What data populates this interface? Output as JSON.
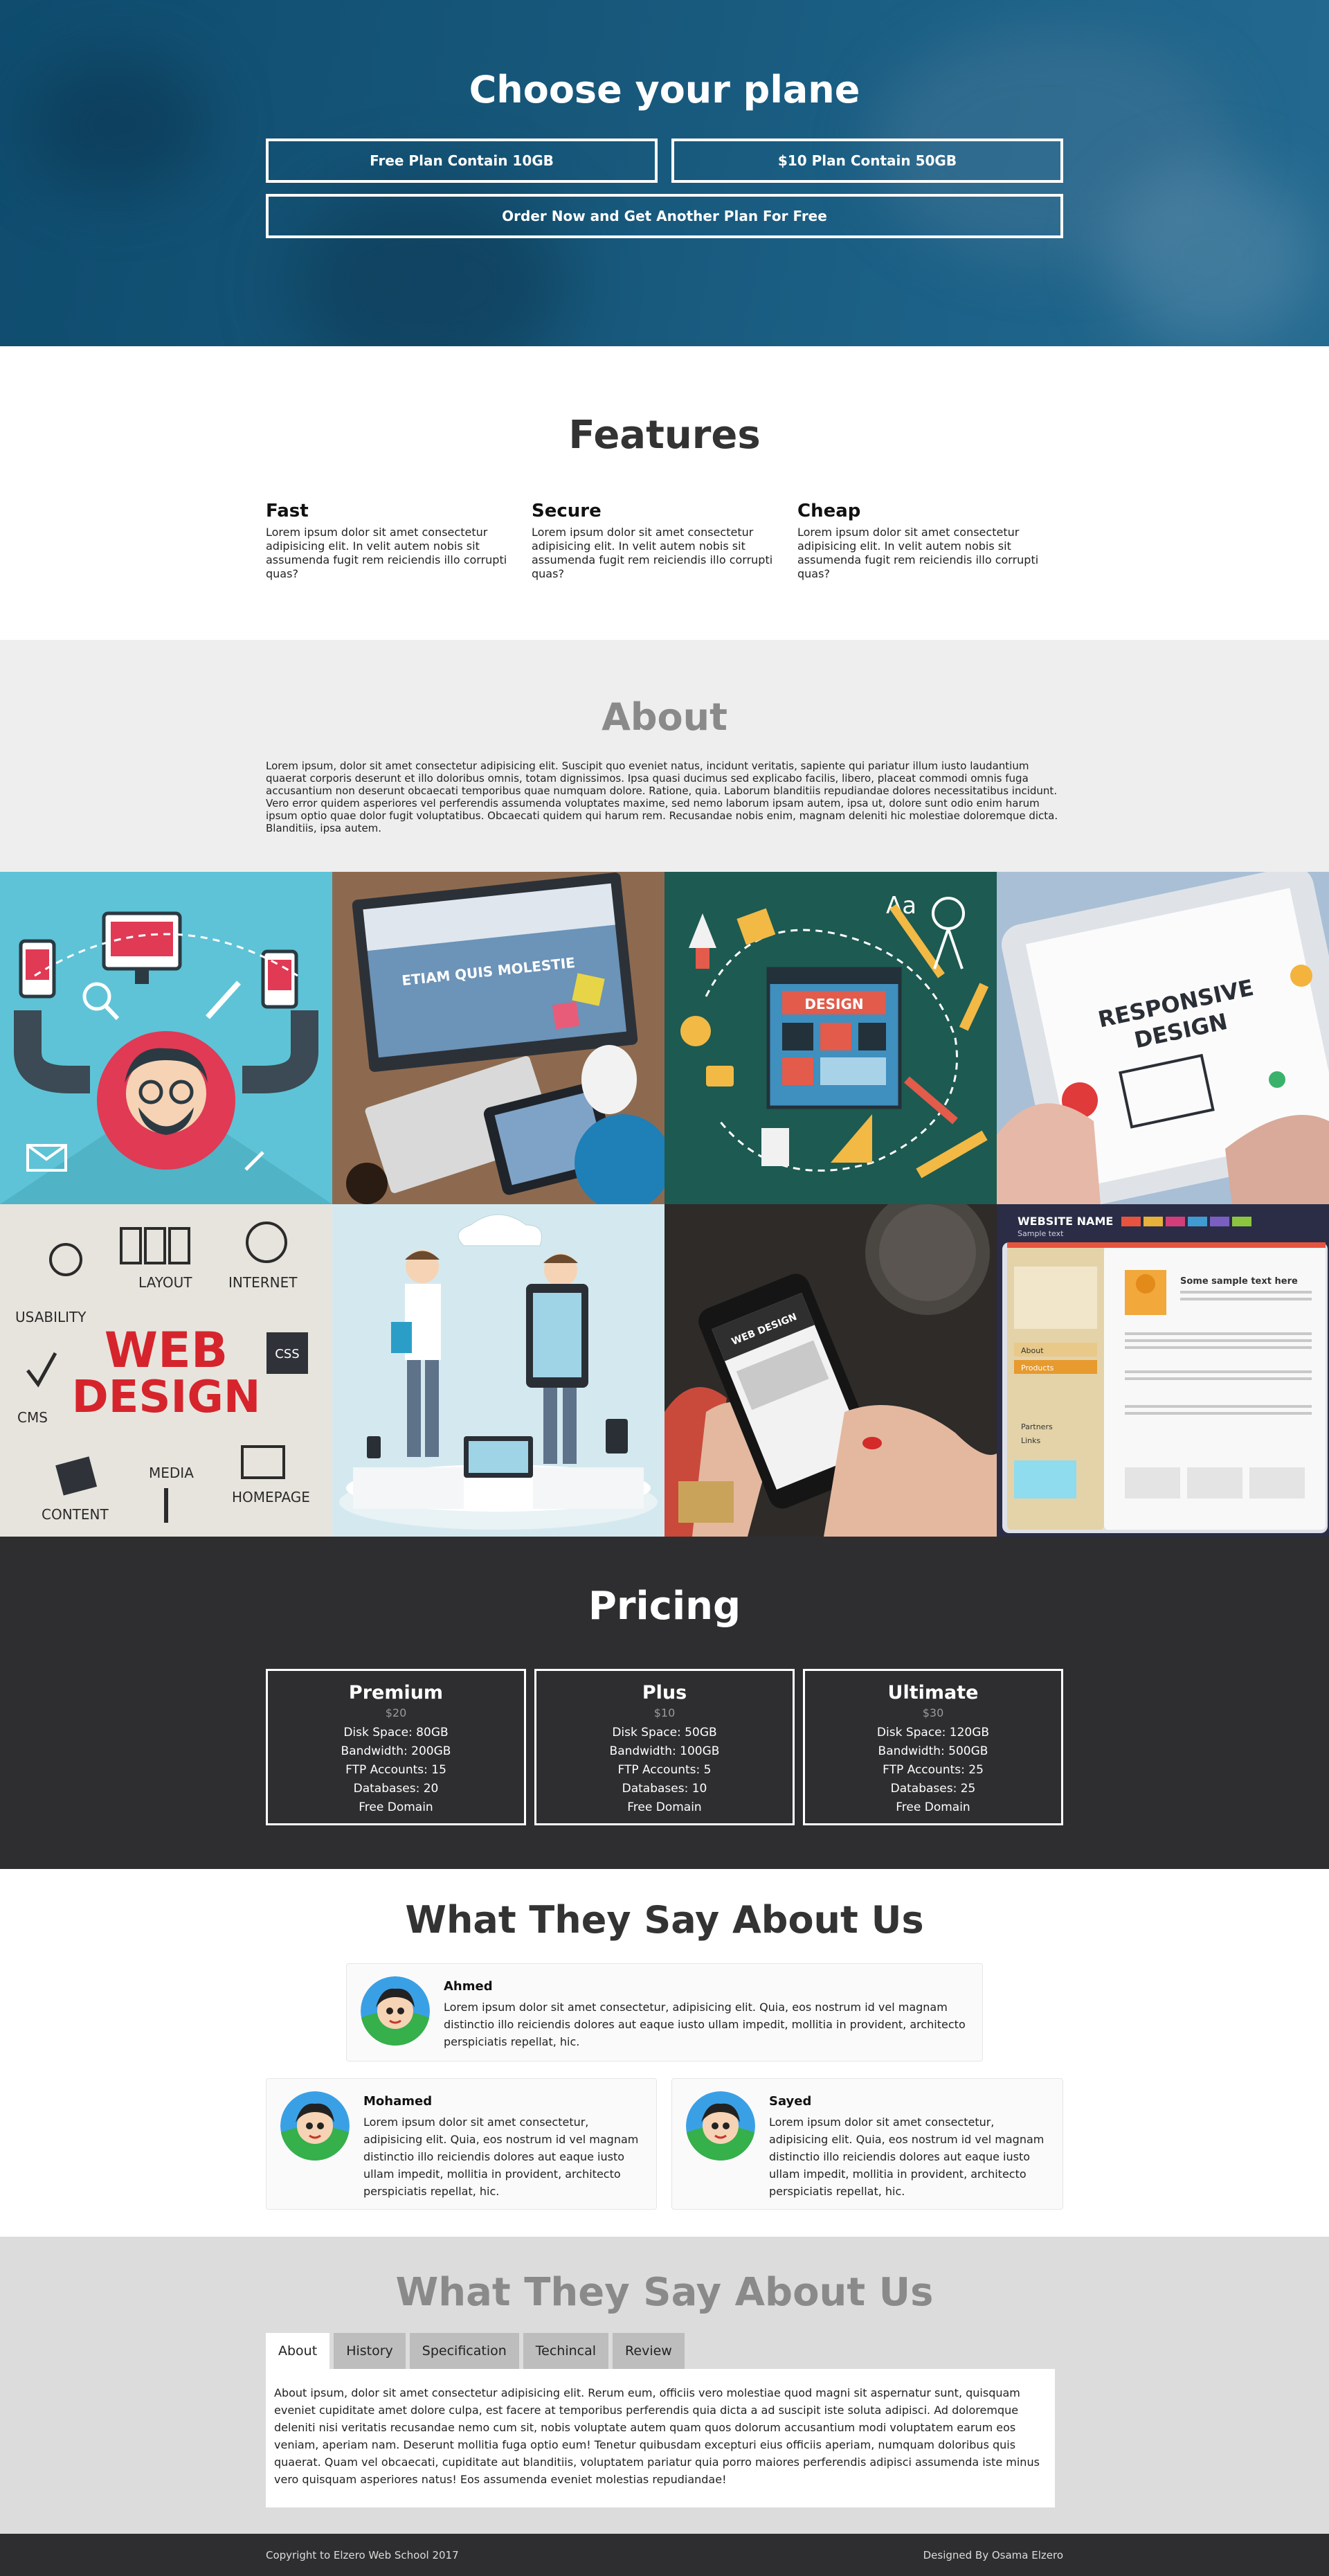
{
  "hero": {
    "title": "Choose your plane",
    "plan_free": "Free Plan Contain 10GB",
    "plan_paid": "$10 Plan Contain 50GB",
    "plan_order": "Order Now and Get Another Plan For Free"
  },
  "features": {
    "title": "Features",
    "items": [
      {
        "title": "Fast",
        "text": "Lorem ipsum dolor sit amet consectetur adipisicing elit. In velit autem nobis sit assumenda fugit rem reiciendis illo corrupti quas?"
      },
      {
        "title": "Secure",
        "text": "Lorem ipsum dolor sit amet consectetur adipisicing elit. In velit autem nobis sit assumenda fugit rem reiciendis illo corrupti quas?"
      },
      {
        "title": "Cheap",
        "text": "Lorem ipsum dolor sit amet consectetur adipisicing elit. In velit autem nobis sit assumenda fugit rem reiciendis illo corrupti quas?"
      }
    ]
  },
  "about": {
    "title": "About",
    "text": "Lorem ipsum, dolor sit amet consectetur adipisicing elit. Suscipit quo eveniet natus, incidunt veritatis, sapiente qui pariatur illum iusto laudantium quaerat corporis deserunt et illo doloribus omnis, totam dignissimos. Ipsa quasi ducimus sed explicabo facilis, libero, placeat commodi omnis fuga accusantium non deserunt obcaecati temporibus quae numquam dolore. Ratione, quia. Laborum blanditiis repudiandae dolores necessitatibus incidunt. Vero error quidem asperiores vel perferendis assumenda voluptates maxime, sed nemo laborum ipsam autem, ipsa ut, dolore sunt odio enim harum ipsum optio quae dolor fugit voluptatibus. Obcaecati quidem qui harum rem. Recusandae nobis enim, magnam deleniti hic molestiae doloremque dicta. Blanditiis, ipsa autem."
  },
  "gallery": {
    "tile2_text": "ETIAM QUIS MOLESTIE",
    "tile3_text": "DESIGN",
    "tile3_aa": "Aa",
    "tile4_line1": "RESPONSIVE",
    "tile4_line2": "DESIGN",
    "tile5_web": "WEB",
    "tile5_design": "DESIGN",
    "tile5_labels": [
      "USABILITY",
      "LAYOUT",
      "INTERNET",
      "CMS",
      "CSS",
      "CONTENT",
      "MEDIA",
      "HOMEPAGE"
    ],
    "tile7_text": "WEB DESIGN",
    "tile8_title": "WEBSITE NAME",
    "tile8_sub": "Sample text",
    "tile8_heading": "Some sample text here",
    "tile8_menu": [
      "About",
      "Products",
      "Partners",
      "Links"
    ]
  },
  "pricing": {
    "title": "Pricing",
    "plans": [
      {
        "name": "Premium",
        "price": "$20",
        "disk": "Disk Space: 80GB",
        "bw": "Bandwidth: 200GB",
        "ftp": "FTP Accounts: 15",
        "db": "Databases: 20",
        "domain": "Free Domain"
      },
      {
        "name": "Plus",
        "price": "$10",
        "disk": "Disk Space: 50GB",
        "bw": "Bandwidth: 100GB",
        "ftp": "FTP Accounts: 5",
        "db": "Databases: 10",
        "domain": "Free Domain"
      },
      {
        "name": "Ultimate",
        "price": "$30",
        "disk": "Disk Space: 120GB",
        "bw": "Bandwidth: 500GB",
        "ftp": "FTP Accounts: 25",
        "db": "Databases: 25",
        "domain": "Free Domain"
      }
    ]
  },
  "testimonials": {
    "title": "What They Say About Us",
    "items": [
      {
        "name": "Ahmed",
        "text": "Lorem ipsum dolor sit amet consectetur, adipisicing elit. Quia, eos nostrum id vel magnam distinctio illo reiciendis dolores aut eaque iusto ullam impedit, mollitia in provident, architecto perspiciatis repellat, hic."
      },
      {
        "name": "Mohamed",
        "text": "Lorem ipsum dolor sit amet consectetur, adipisicing elit. Quia, eos nostrum id vel magnam distinctio illo reiciendis dolores aut eaque iusto ullam impedit, mollitia in provident, architecto perspiciatis repellat, hic."
      },
      {
        "name": "Sayed",
        "text": "Lorem ipsum dolor sit amet consectetur, adipisicing elit. Quia, eos nostrum id vel magnam distinctio illo reiciendis dolores aut eaque iusto ullam impedit, mollitia in provident, architecto perspiciatis repellat, hic."
      }
    ]
  },
  "tabs": {
    "title": "What They Say About Us",
    "items": [
      "About",
      "History",
      "Specification",
      "Techincal",
      "Review"
    ],
    "active": "About",
    "content": "About ipsum, dolor sit amet consectetur adipisicing elit. Rerum eum, officiis vero molestiae quod magni sit aspernatur sunt, quisquam eveniet cupiditate amet dolore culpa, est facere at temporibus perferendis quia dicta a ad suscipit iste soluta adipisci. Ad doloremque deleniti nisi veritatis recusandae nemo cum sit, nobis voluptate autem quam quos dolorum accusantium modi voluptatem earum eos veniam, aperiam nam. Deserunt mollitia fuga optio eum! Tenetur quibusdam excepturi eius officiis aperiam, numquam doloribus quis quaerat. Quam vel obcaecati, cupiditate aut blanditiis, voluptatem pariatur quia porro maiores perferendis adipisci assumenda iste minus vero quisquam asperiores natus! Eos assumenda eveniet molestias repudiandae!"
  },
  "footer": {
    "copyright": "Copyright to Elzero Web School 2017",
    "designer": "Designed By Osama Elzero"
  },
  "colors": {
    "hero_bg": "#17587b",
    "dark_bg": "#2e2e30",
    "light_bg": "#eeeeee",
    "tab_bg": "#dcdcdc"
  }
}
